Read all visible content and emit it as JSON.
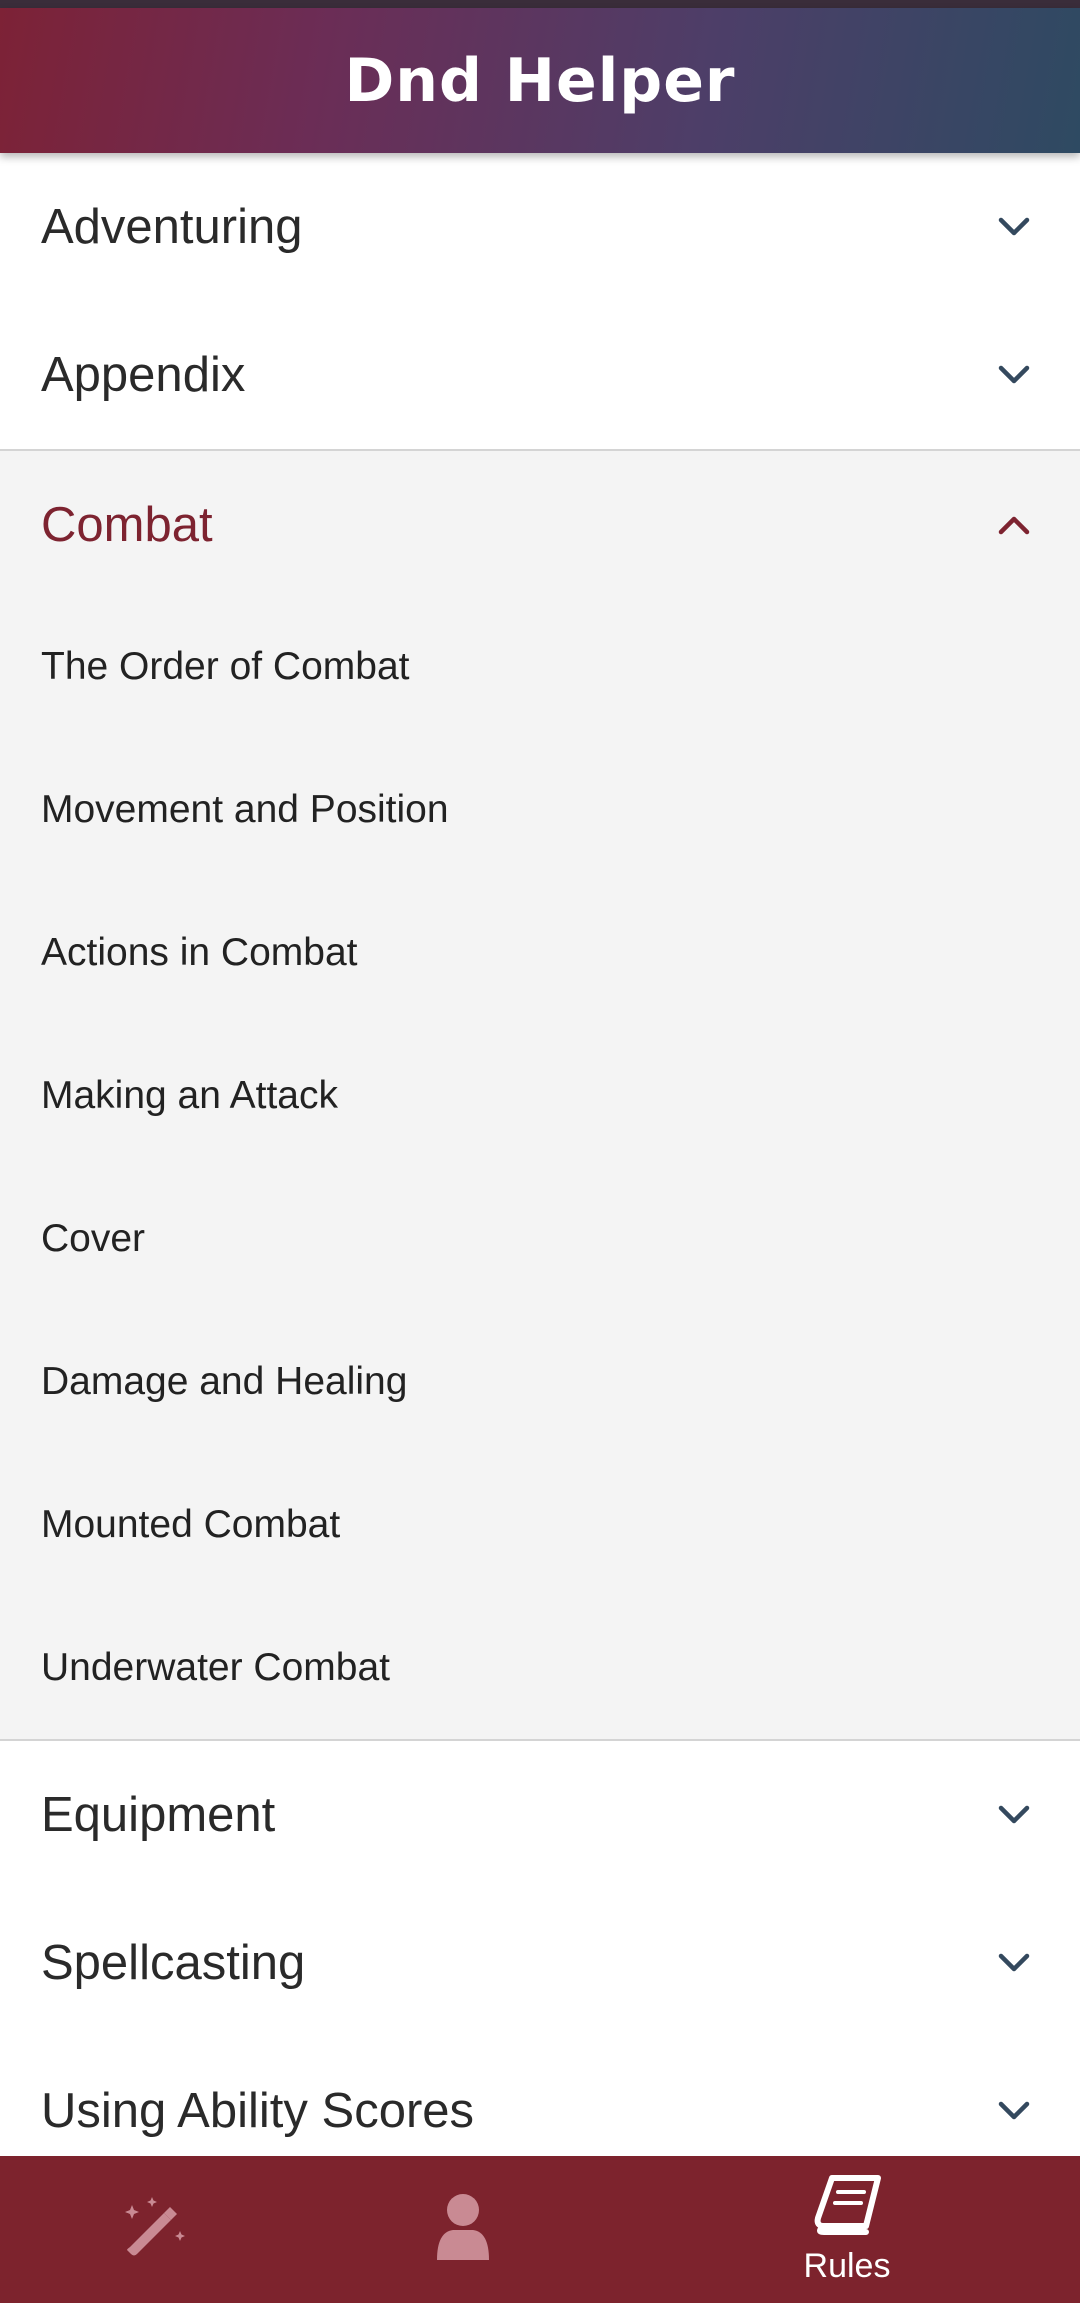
{
  "app": {
    "title": "Dnd Helper"
  },
  "sections": {
    "adventuring": {
      "label": "Adventuring",
      "icon": "chevron-down-icon"
    },
    "appendix": {
      "label": "Appendix",
      "icon": "chevron-down-icon"
    },
    "combat": {
      "label": "Combat",
      "icon": "chevron-up-icon",
      "items": [
        "The Order of Combat",
        "Movement and Position",
        "Actions in Combat",
        "Making an Attack",
        "Cover",
        "Damage and Healing",
        "Mounted Combat",
        "Underwater Combat"
      ]
    },
    "equipment": {
      "label": "Equipment",
      "icon": "chevron-down-icon"
    },
    "spellcasting": {
      "label": "Spellcasting",
      "icon": "chevron-down-icon"
    },
    "ability_scores": {
      "label": "Using Ability Scores",
      "icon": "chevron-down-icon"
    }
  },
  "bottom_nav": {
    "items": [
      {
        "icon": "magic-wand-icon",
        "label": "",
        "active": false
      },
      {
        "icon": "user-icon",
        "label": "",
        "active": false
      },
      {
        "icon": "book-icon",
        "label": "Rules",
        "active": true
      }
    ]
  },
  "colors": {
    "accent": "#7d232d",
    "header_gradient_start": "#7d2236",
    "header_gradient_end": "#2e4a62",
    "expanded_bg": "#f4f4f4",
    "inactive_icon": "#c98a93",
    "chevron": "#34495e"
  }
}
